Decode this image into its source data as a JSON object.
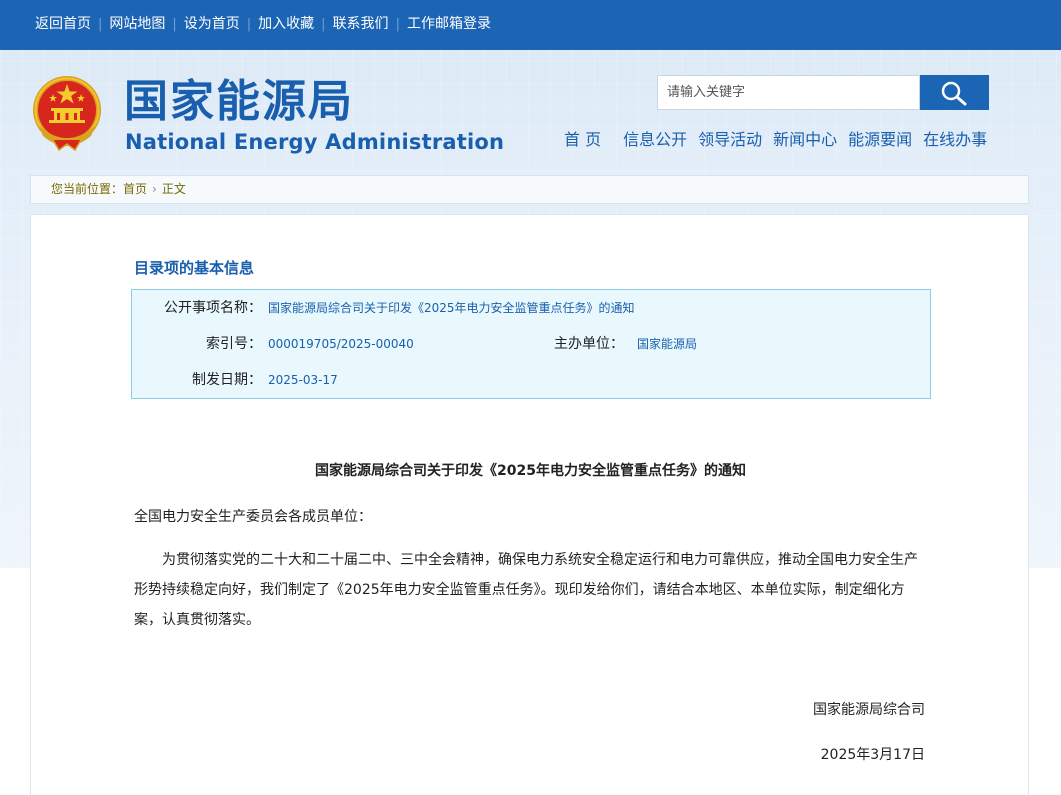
{
  "topbar": {
    "links": [
      "返回首页",
      "网站地图",
      "设为首页",
      "加入收藏",
      "联系我们",
      "工作邮箱登录"
    ]
  },
  "header": {
    "logo_cn": "国家能源局",
    "logo_en": "National Energy Administration",
    "emblem_icon": "national-emblem-icon",
    "search": {
      "placeholder": "请输入关键字",
      "button_icon": "search-icon"
    },
    "nav": [
      "首 页",
      "信息公开",
      "领导活动",
      "新闻中心",
      "能源要闻",
      "在线办事"
    ]
  },
  "breadcrumb": {
    "label": "您当前位置：",
    "items": [
      "首页",
      "正文"
    ]
  },
  "meta": {
    "heading": "目录项的基本信息",
    "item_name_label": "公开事项名称：",
    "item_name": "国家能源局综合司关于印发《2025年电力安全监管重点任务》的通知",
    "index_label": "索引号：",
    "index": "000019705/2025-00040",
    "org_label": "主办单位：",
    "org": "国家能源局",
    "date_label": "制发日期：",
    "date": "2025-03-17"
  },
  "document": {
    "title": "国家能源局综合司关于印发《2025年电力安全监管重点任务》的通知",
    "salutation": "全国电力安全生产委员会各成员单位：",
    "body": "为贯彻落实党的二十大和二十届二中、三中全会精神，确保电力系统安全稳定运行和电力可靠供应，推动全国电力安全生产形势持续稳定向好，我们制定了《2025年电力安全监管重点任务》。现印发给你们，请结合本地区、本单位实际，制定细化方案，认真贯彻落实。",
    "signer": "国家能源局综合司",
    "sign_date": "2025年3月17日"
  },
  "colors": {
    "brand_blue": "#1c64b4",
    "logo_blue": "#1a5fae",
    "meta_bg": "#e8f8fd",
    "meta_border": "#8bcfe6"
  }
}
